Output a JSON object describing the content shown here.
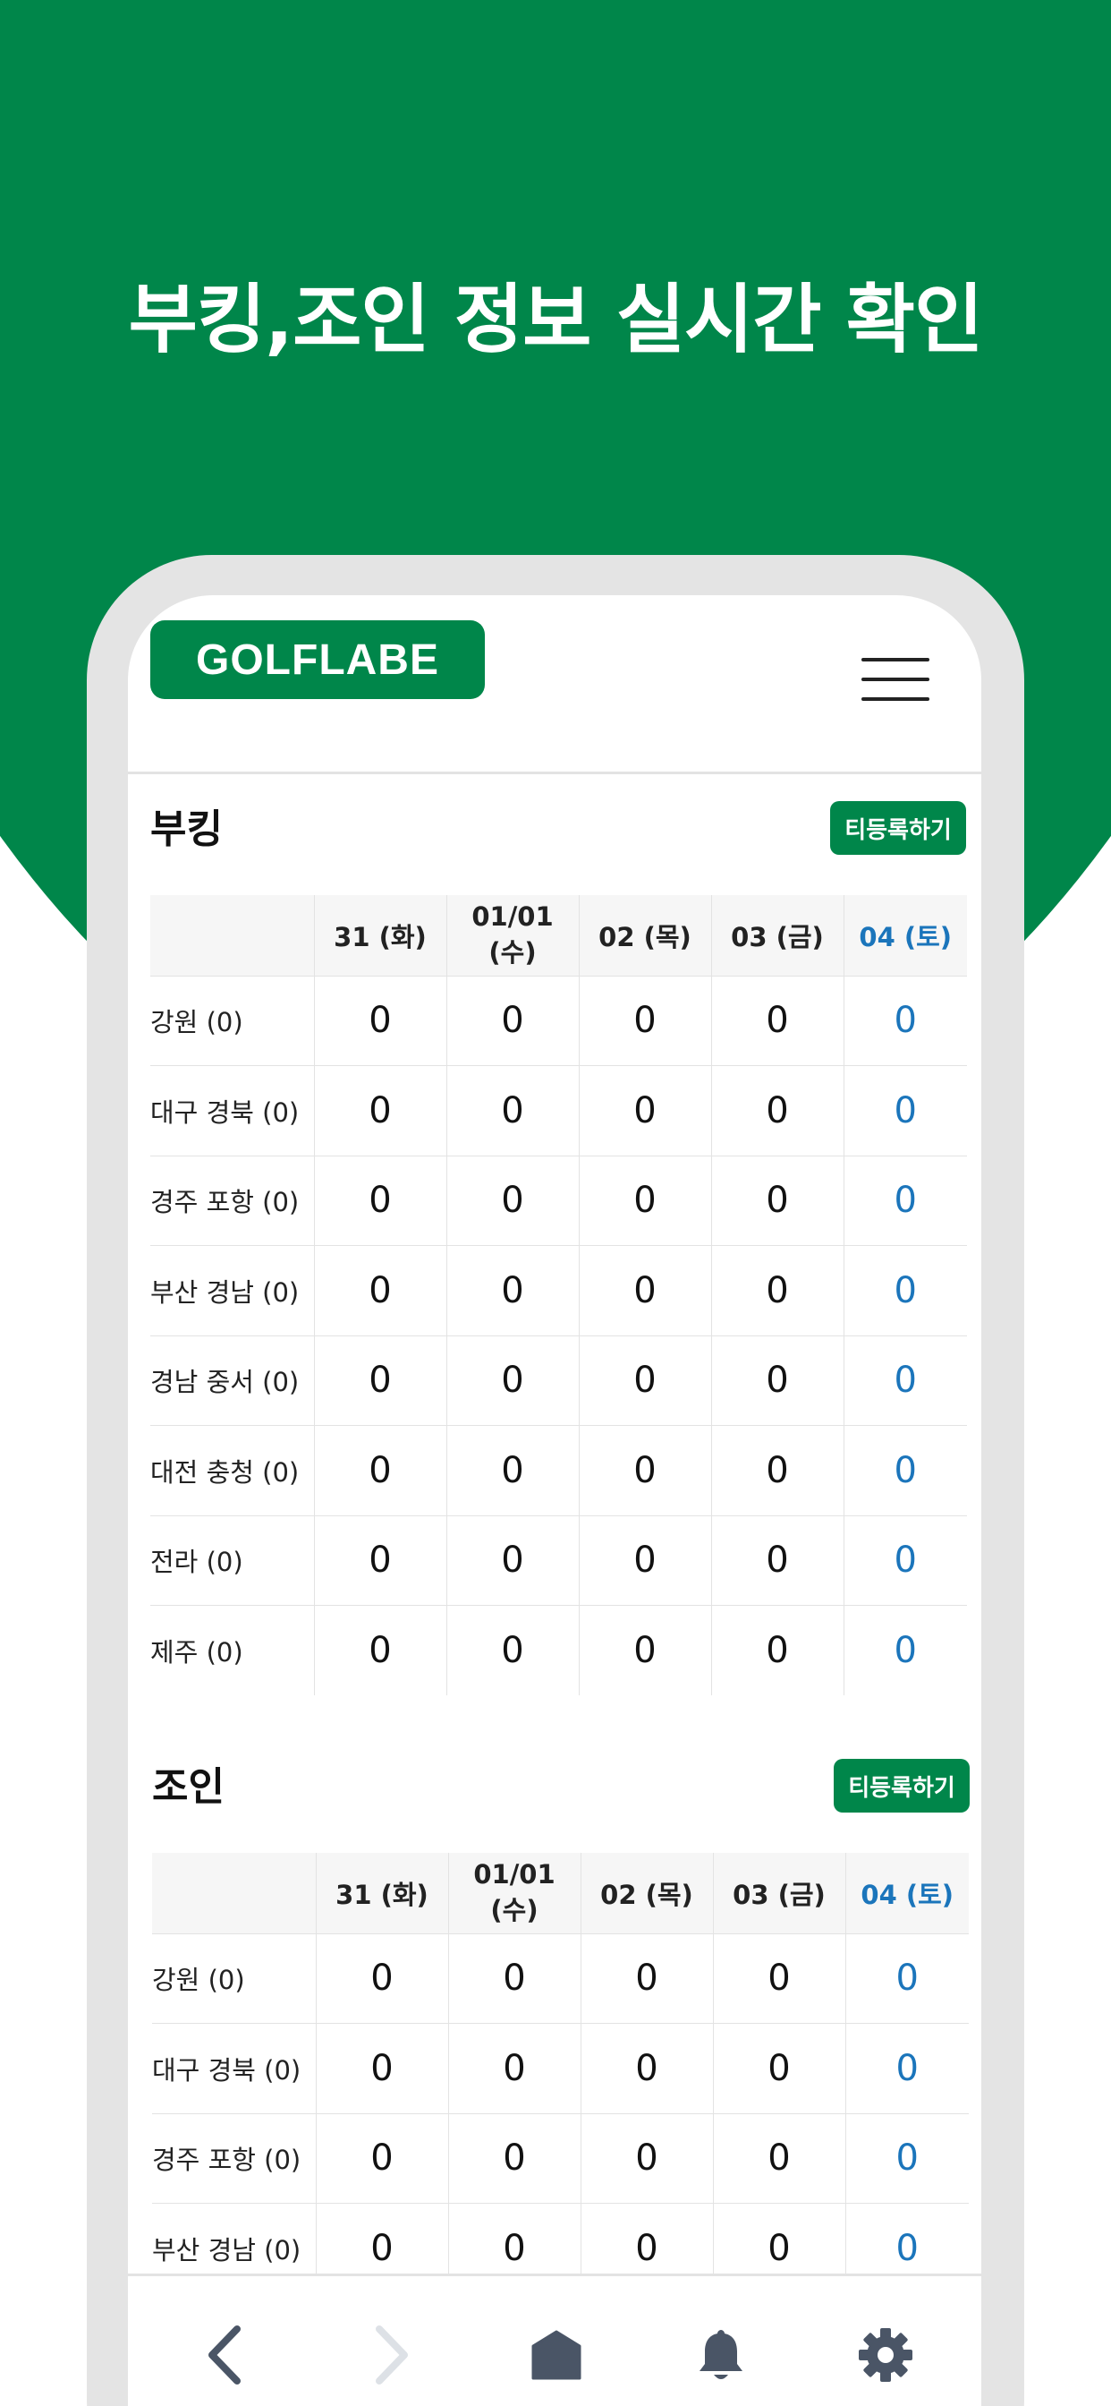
{
  "headline": "부킹,조인 정보 실시간 확인",
  "app": {
    "logo": "GOLFLABE",
    "menu_icon": "hamburger-menu-icon"
  },
  "booking": {
    "title": "부킹",
    "register_label": "티등록하기",
    "columns": [
      "31 (화)",
      "01/01 (수)",
      "02 (목)",
      "03 (금)",
      "04 (토)"
    ],
    "rows": [
      {
        "region": "강원 (0)",
        "values": [
          "0",
          "0",
          "0",
          "0",
          "0"
        ]
      },
      {
        "region": "대구 경북 (0)",
        "values": [
          "0",
          "0",
          "0",
          "0",
          "0"
        ]
      },
      {
        "region": "경주 포항 (0)",
        "values": [
          "0",
          "0",
          "0",
          "0",
          "0"
        ]
      },
      {
        "region": "부산 경남 (0)",
        "values": [
          "0",
          "0",
          "0",
          "0",
          "0"
        ]
      },
      {
        "region": "경남 중서 (0)",
        "values": [
          "0",
          "0",
          "0",
          "0",
          "0"
        ]
      },
      {
        "region": "대전 충청 (0)",
        "values": [
          "0",
          "0",
          "0",
          "0",
          "0"
        ]
      },
      {
        "region": "전라 (0)",
        "values": [
          "0",
          "0",
          "0",
          "0",
          "0"
        ]
      },
      {
        "region": "제주 (0)",
        "values": [
          "0",
          "0",
          "0",
          "0",
          "0"
        ]
      }
    ]
  },
  "join": {
    "title": "조인",
    "register_label": "티등록하기",
    "columns": [
      "31 (화)",
      "01/01 (수)",
      "02 (목)",
      "03 (금)",
      "04 (토)"
    ],
    "rows": [
      {
        "region": "강원 (0)",
        "values": [
          "0",
          "0",
          "0",
          "0",
          "0"
        ]
      },
      {
        "region": "대구 경북 (0)",
        "values": [
          "0",
          "0",
          "0",
          "0",
          "0"
        ]
      },
      {
        "region": "경주 포항 (0)",
        "values": [
          "0",
          "0",
          "0",
          "0",
          "0"
        ]
      },
      {
        "region": "부산 경남 (0)",
        "values": [
          "0",
          "0",
          "0",
          "0",
          "0"
        ]
      }
    ]
  },
  "bottom_nav": [
    {
      "name": "back-icon"
    },
    {
      "name": "forward-icon"
    },
    {
      "name": "home-icon"
    },
    {
      "name": "bell-icon"
    },
    {
      "name": "gear-icon"
    }
  ],
  "colors": {
    "brand_green": "#00864a",
    "saturday_blue": "#1b75bb",
    "nav_dark": "#4a5566",
    "nav_disabled": "#dde1e6"
  }
}
